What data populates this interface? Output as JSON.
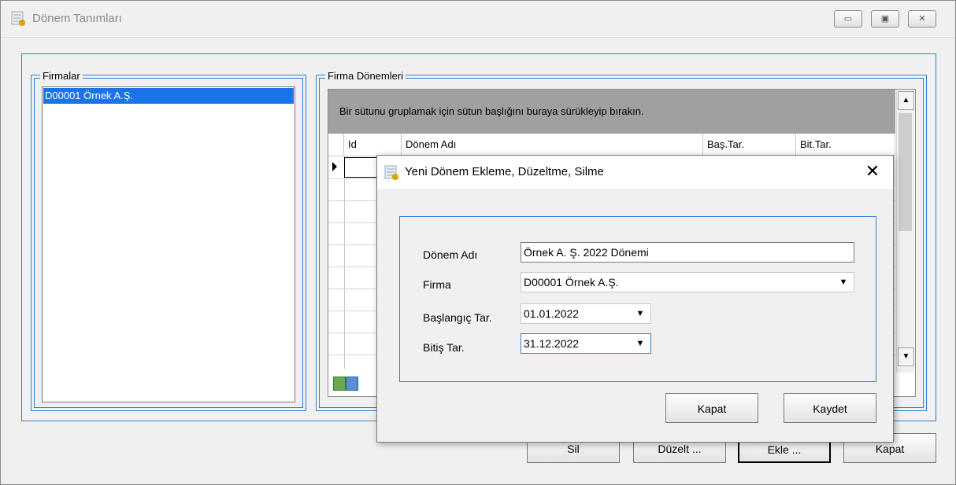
{
  "main_window": {
    "title": "Dönem Tanımları",
    "firmalar_label": "Firmalar",
    "firma_donemleri_label": "Firma Dönemleri",
    "firma_items": [
      "D00001  Örnek A.Ş."
    ],
    "grid": {
      "group_hint": "Bir sütunu gruplamak için sütun başlığını buraya sürükleyip bırakın.",
      "columns": [
        "Id",
        "Dönem Adı",
        "Baş.Tar.",
        "Bit.Tar."
      ]
    },
    "buttons": {
      "sil": "Sil",
      "duzelt": "Düzelt ...",
      "ekle": "Ekle ...",
      "kapat": "Kapat"
    }
  },
  "dialog": {
    "title": "Yeni Dönem Ekleme, Düzeltme, Silme",
    "close_glyph": "✕",
    "fields": {
      "donem_adi_label": "Dönem Adı",
      "donem_adi_value": "Örnek A. Ş. 2022 Dönemi",
      "firma_label": "Firma",
      "firma_value": "D00001  Örnek A.Ş.",
      "baslangic_label": "Başlangıç Tar.",
      "baslangic_value": "01.01.2022",
      "bitis_label": "Bitiş Tar.",
      "bitis_value": "31.12.2022"
    },
    "buttons": {
      "kapat": "Kapat",
      "kaydet": "Kaydet"
    }
  },
  "icons": {
    "app_icon": "app-calendar-icon",
    "dropdown": "chevron-down-icon",
    "scroll_up": "scroll-up-icon",
    "scroll_down": "scroll-down-icon"
  },
  "colors": {
    "accent_blue": "#2f7fd4",
    "selection_blue": "#1a73e8",
    "group_panel_gray": "#a0a0a0"
  }
}
